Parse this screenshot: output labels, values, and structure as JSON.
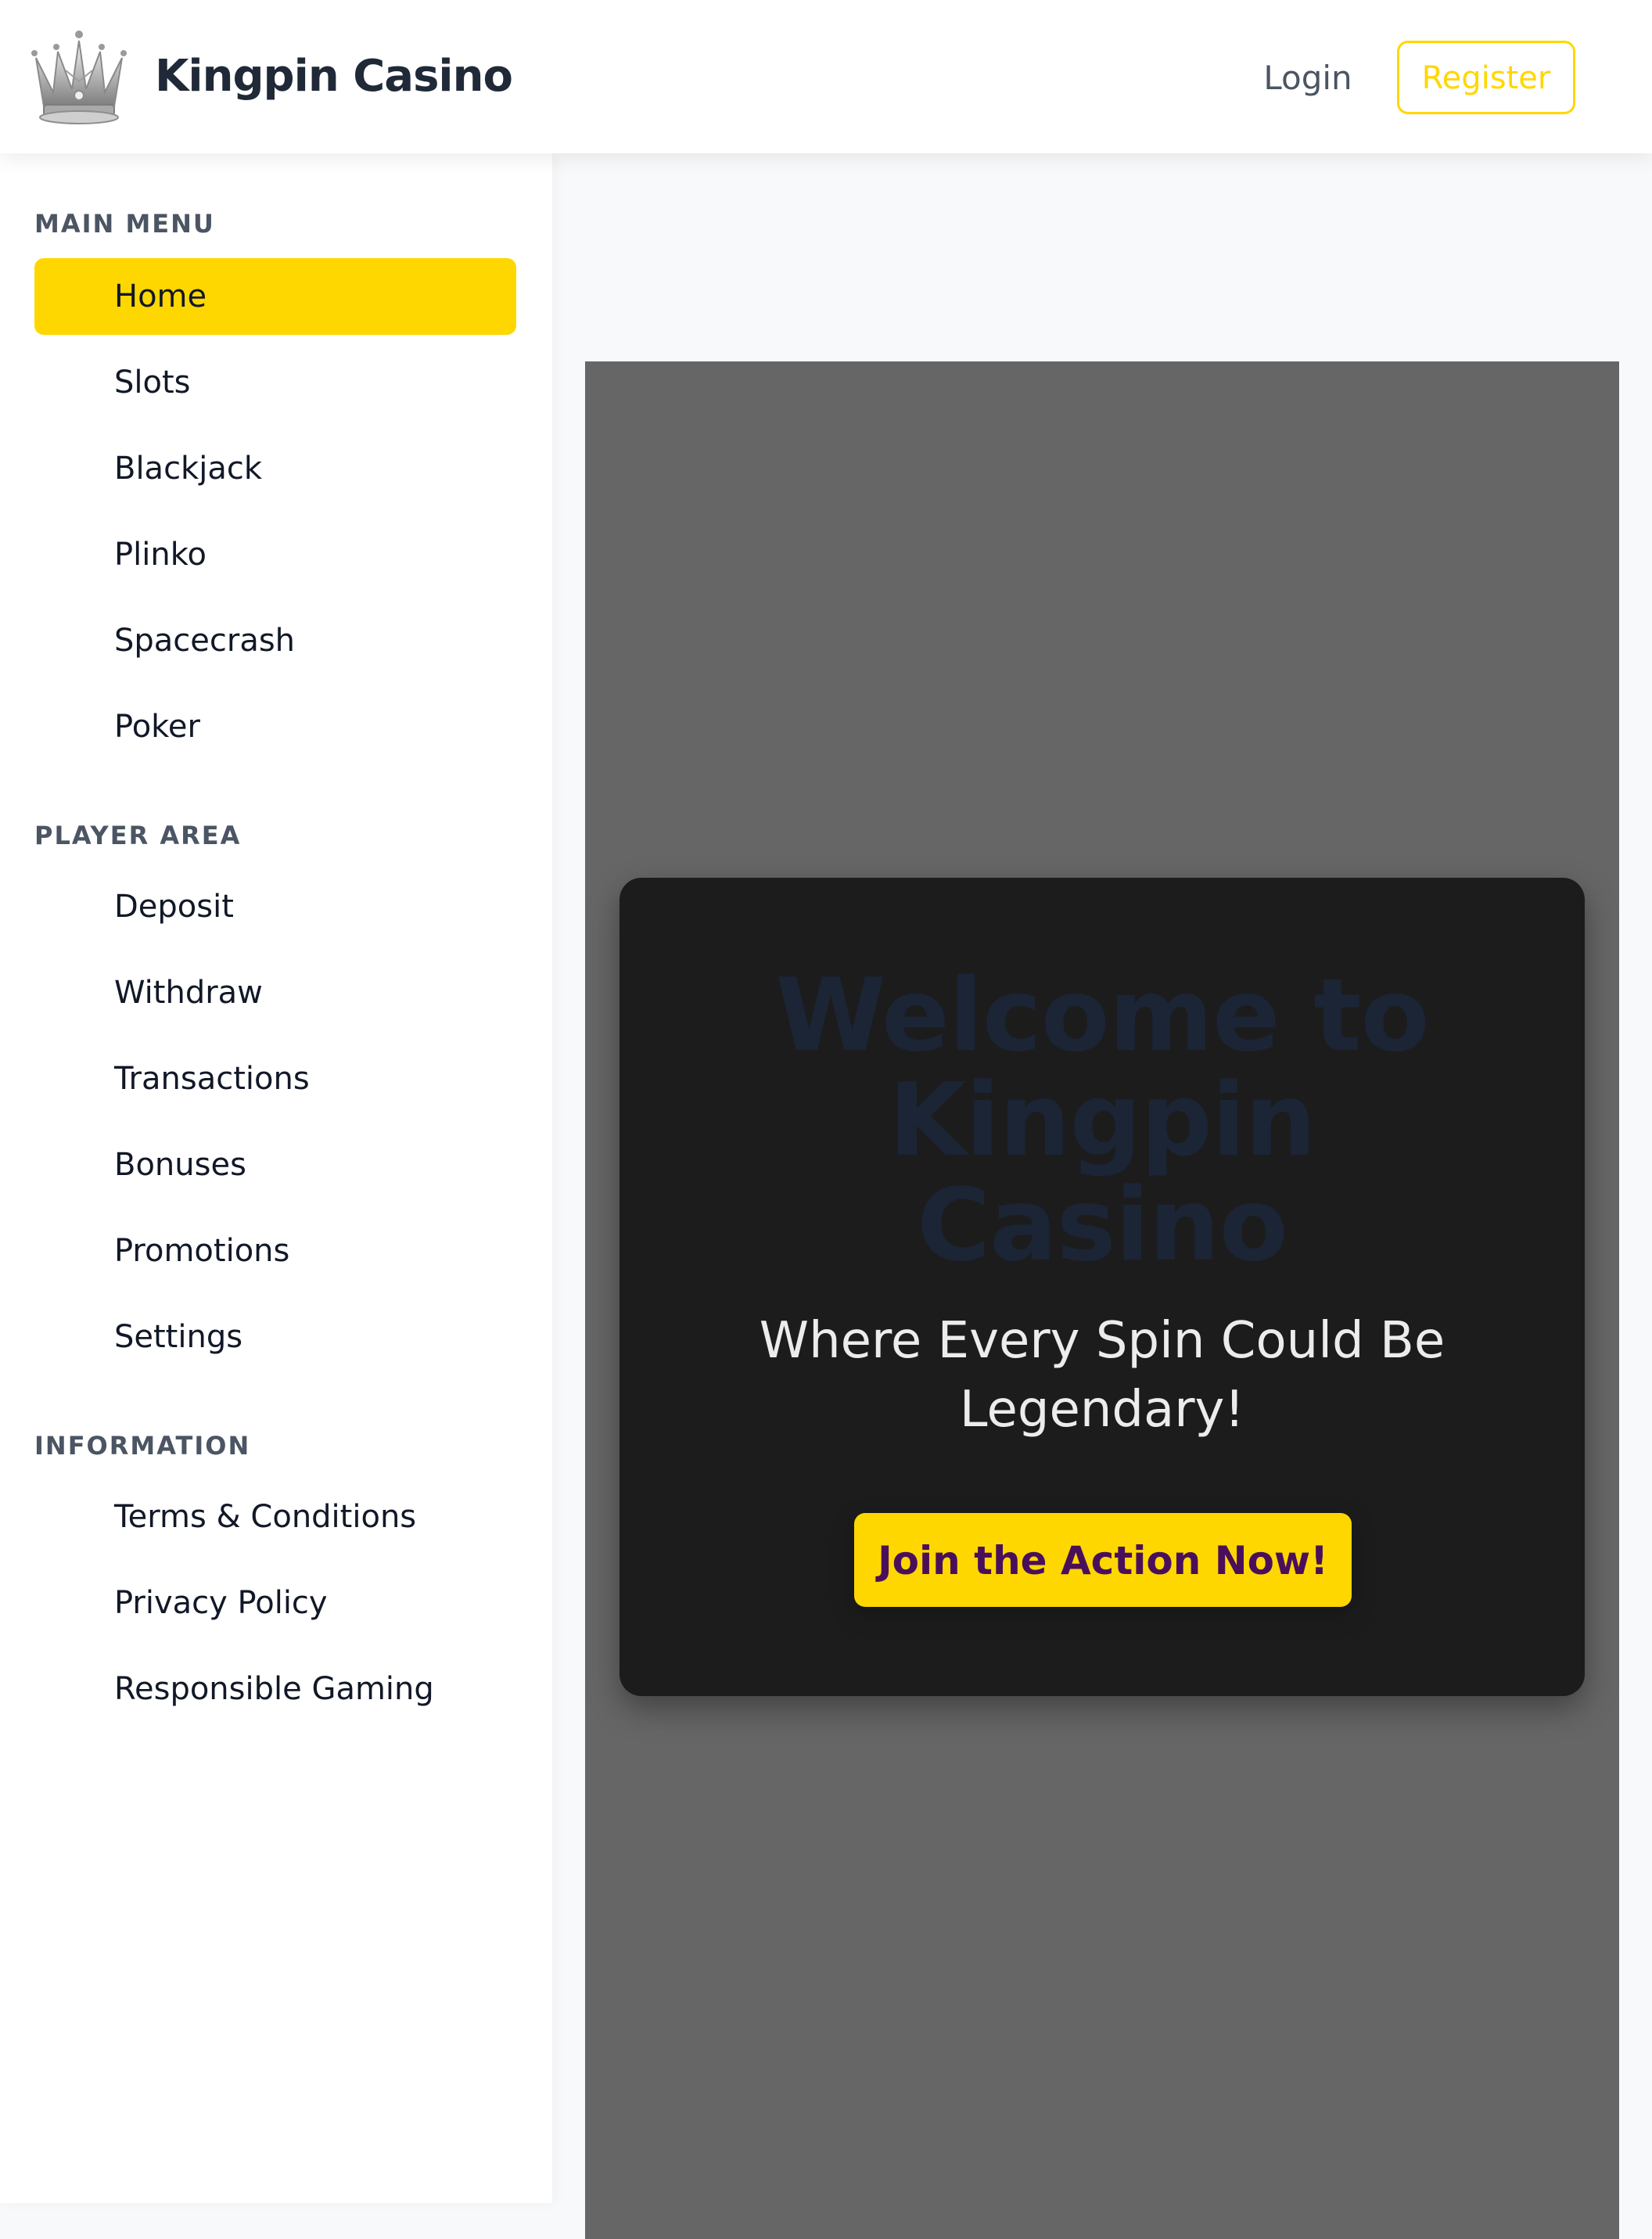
{
  "header": {
    "logo_icon": "crown-icon",
    "brand_name": "Kingpin Casino",
    "login_label": "Login",
    "register_label": "Register"
  },
  "sidebar": {
    "sections": [
      {
        "title": "MAIN MENU",
        "items": [
          {
            "label": "Home",
            "active": true
          },
          {
            "label": "Slots"
          },
          {
            "label": "Blackjack"
          },
          {
            "label": "Plinko"
          },
          {
            "label": "Spacecrash"
          },
          {
            "label": "Poker"
          }
        ]
      },
      {
        "title": "PLAYER AREA",
        "items": [
          {
            "label": "Deposit"
          },
          {
            "label": "Withdraw"
          },
          {
            "label": "Transactions"
          },
          {
            "label": "Bonuses"
          },
          {
            "label": "Promotions"
          },
          {
            "label": "Settings"
          }
        ]
      },
      {
        "title": "INFORMATION",
        "items": [
          {
            "label": "Terms & Conditions"
          },
          {
            "label": "Privacy Policy"
          },
          {
            "label": "Responsible Gaming"
          }
        ]
      }
    ]
  },
  "hero": {
    "title": "Welcome to Kingpin Casino",
    "subtitle": "Where Every Spin Could Be Legendary!",
    "cta_label": "Join the Action Now!"
  },
  "colors": {
    "accent": "#ffd700",
    "hero_background": "#666666",
    "card_background": "#1c1c1c",
    "cta_text": "#4a0f5b"
  }
}
